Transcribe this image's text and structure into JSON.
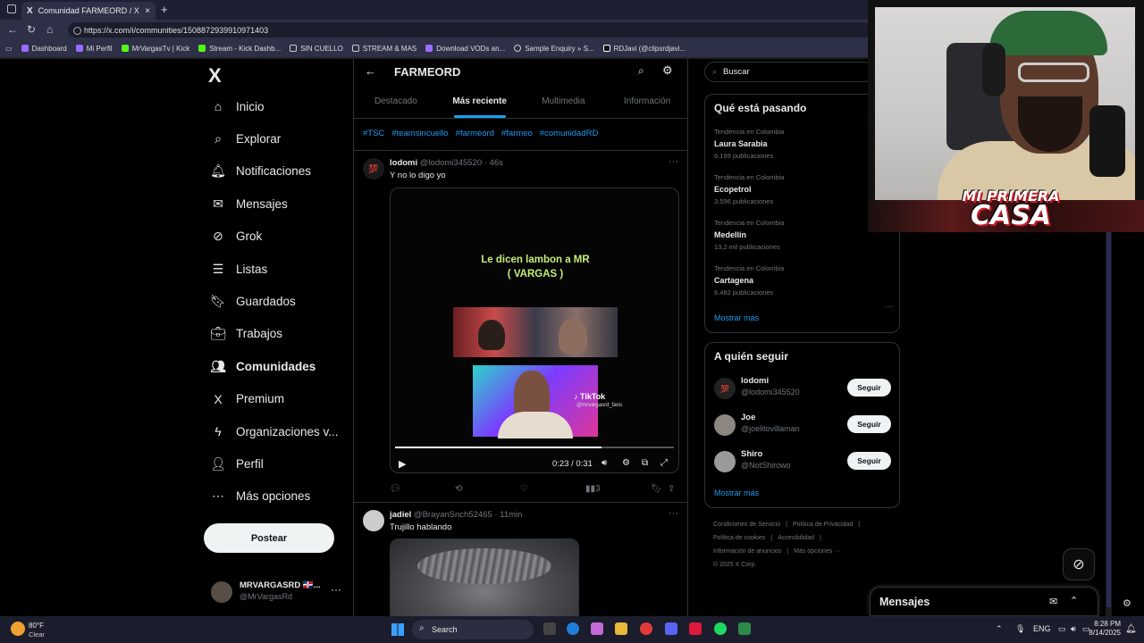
{
  "browser": {
    "tab_title": "Comunidad FARMEORD / X",
    "tab_close": "×",
    "tab_new": "+",
    "url": "https://x.com/i/communities/1508872939910971403",
    "bookmarks": [
      {
        "label": "Dashboard",
        "icon": "twitch-icon"
      },
      {
        "label": "Mi Perfil",
        "icon": "twitch-icon"
      },
      {
        "label": "MrVargasTv | Kick",
        "icon": "kick-icon"
      },
      {
        "label": "Stream - Kick Dashb...",
        "icon": "kick-icon"
      },
      {
        "label": "SIN CUELLO",
        "icon": "folder-icon"
      },
      {
        "label": "STREAM & MAS",
        "icon": "folder-icon"
      },
      {
        "label": "Download VODs an...",
        "icon": "twitch-icon"
      },
      {
        "label": "Sample Enquiry » S...",
        "icon": "globe-icon"
      },
      {
        "label": "RDJavi (@clipsrdjavi...",
        "icon": "tiktok-icon"
      }
    ]
  },
  "sidebar": {
    "logo": "X",
    "items": [
      {
        "label": "Inicio",
        "icon": "⌂",
        "name": "home"
      },
      {
        "label": "Explorar",
        "icon": "⌕",
        "name": "explore"
      },
      {
        "label": "Notificaciones",
        "icon": "🔔︎",
        "name": "notifications"
      },
      {
        "label": "Mensajes",
        "icon": "✉",
        "name": "messages"
      },
      {
        "label": "Grok",
        "icon": "⊘",
        "name": "grok"
      },
      {
        "label": "Listas",
        "icon": "☰",
        "name": "lists"
      },
      {
        "label": "Guardados",
        "icon": "🔖︎",
        "name": "bookmarks"
      },
      {
        "label": "Trabajos",
        "icon": "💼︎",
        "name": "jobs"
      },
      {
        "label": "Comunidades",
        "icon": "👥︎",
        "name": "communities"
      },
      {
        "label": "Premium",
        "icon": "X",
        "name": "premium"
      },
      {
        "label": "Organizaciones v...",
        "icon": "ϟ",
        "name": "organizations"
      },
      {
        "label": "Perfil",
        "icon": "👤︎",
        "name": "profile"
      },
      {
        "label": "Más opciones",
        "icon": "⋯",
        "name": "more"
      }
    ],
    "post_button": "Postear",
    "account": {
      "name": "MRVARGASRD 🇩🇴...",
      "handle": "@MrVargasRd",
      "more": "···"
    }
  },
  "community": {
    "title": "FARMEORD",
    "tabs": [
      "Destacado",
      "Más reciente",
      "Multimedia",
      "Información"
    ],
    "active_tab": 1,
    "hashtags": [
      "#TSC",
      "#teamsincuello",
      "#farmeord",
      "#farmeo",
      "#comunidadRD"
    ]
  },
  "tweets": [
    {
      "name": "lodomi",
      "handle": "@lodomi345520",
      "time": "46s",
      "text": "Y no lo digo yo",
      "avatar": "💯",
      "video": {
        "caption_line1": "Le dicen lambon a MR",
        "caption_line2": "( VARGAS )",
        "tiktok_label": "TikTok",
        "tiktok_user": "@mrvargasrd_fans",
        "current_time": "0:23 / 0:31",
        "progress": 0.74
      },
      "views": "3"
    },
    {
      "name": "jadiel",
      "handle": "@BrayanSnch52465",
      "time": "11min",
      "text": "Trujillo hablando"
    }
  ],
  "right": {
    "search_placeholder": "Buscar",
    "trending_title": "Qué está pasando",
    "trends": [
      {
        "context": "Tendencia en Colombia",
        "name": "Laura Sarabia",
        "posts": "6.199 publicaciones"
      },
      {
        "context": "Tendencia en Colombia",
        "name": "Ecopetrol",
        "posts": "3.596 publicaciones"
      },
      {
        "context": "Tendencia en Colombia",
        "name": "Medellín",
        "posts": "13,2 mil publicaciones"
      },
      {
        "context": "Tendencia en Colombia",
        "name": "Cartagena",
        "posts": "6.482 publicaciones"
      }
    ],
    "show_more": "Mostrar más",
    "who_title": "A quién seguir",
    "who": [
      {
        "name": "lodomi",
        "handle": "@lodomi345520",
        "button": "Seguir",
        "avatar": "💯"
      },
      {
        "name": "Joe",
        "handle": "@joelitovillaman",
        "button": "Seguir",
        "avatar": ""
      },
      {
        "name": "Shiro",
        "handle": "@NotShirowo",
        "button": "Seguir",
        "avatar": ""
      }
    ],
    "who_more": "Mostrar más",
    "footer": [
      "Condiciones de Servicio",
      "|",
      "Política de Privacidad",
      "|",
      "Política de cookies",
      "|",
      "Accesibilidad",
      "|",
      "Información de anuncios",
      "|",
      "Más opciones ···",
      "© 2025 X Corp."
    ]
  },
  "overlay": {
    "logo_line1": "MI PRIMERA",
    "logo_line2": "CASA"
  },
  "messages_dock": {
    "title": "Mensajes"
  },
  "taskbar": {
    "weather_temp": "80°F",
    "weather_desc": "Clear",
    "search": "Search",
    "lang": "ENG",
    "time": "8:28 PM",
    "date": "8/14/2025"
  },
  "colors": {
    "accent": "#1d9bf0",
    "background": "#000000",
    "text": "#e7e9ea",
    "muted": "#71767b"
  }
}
